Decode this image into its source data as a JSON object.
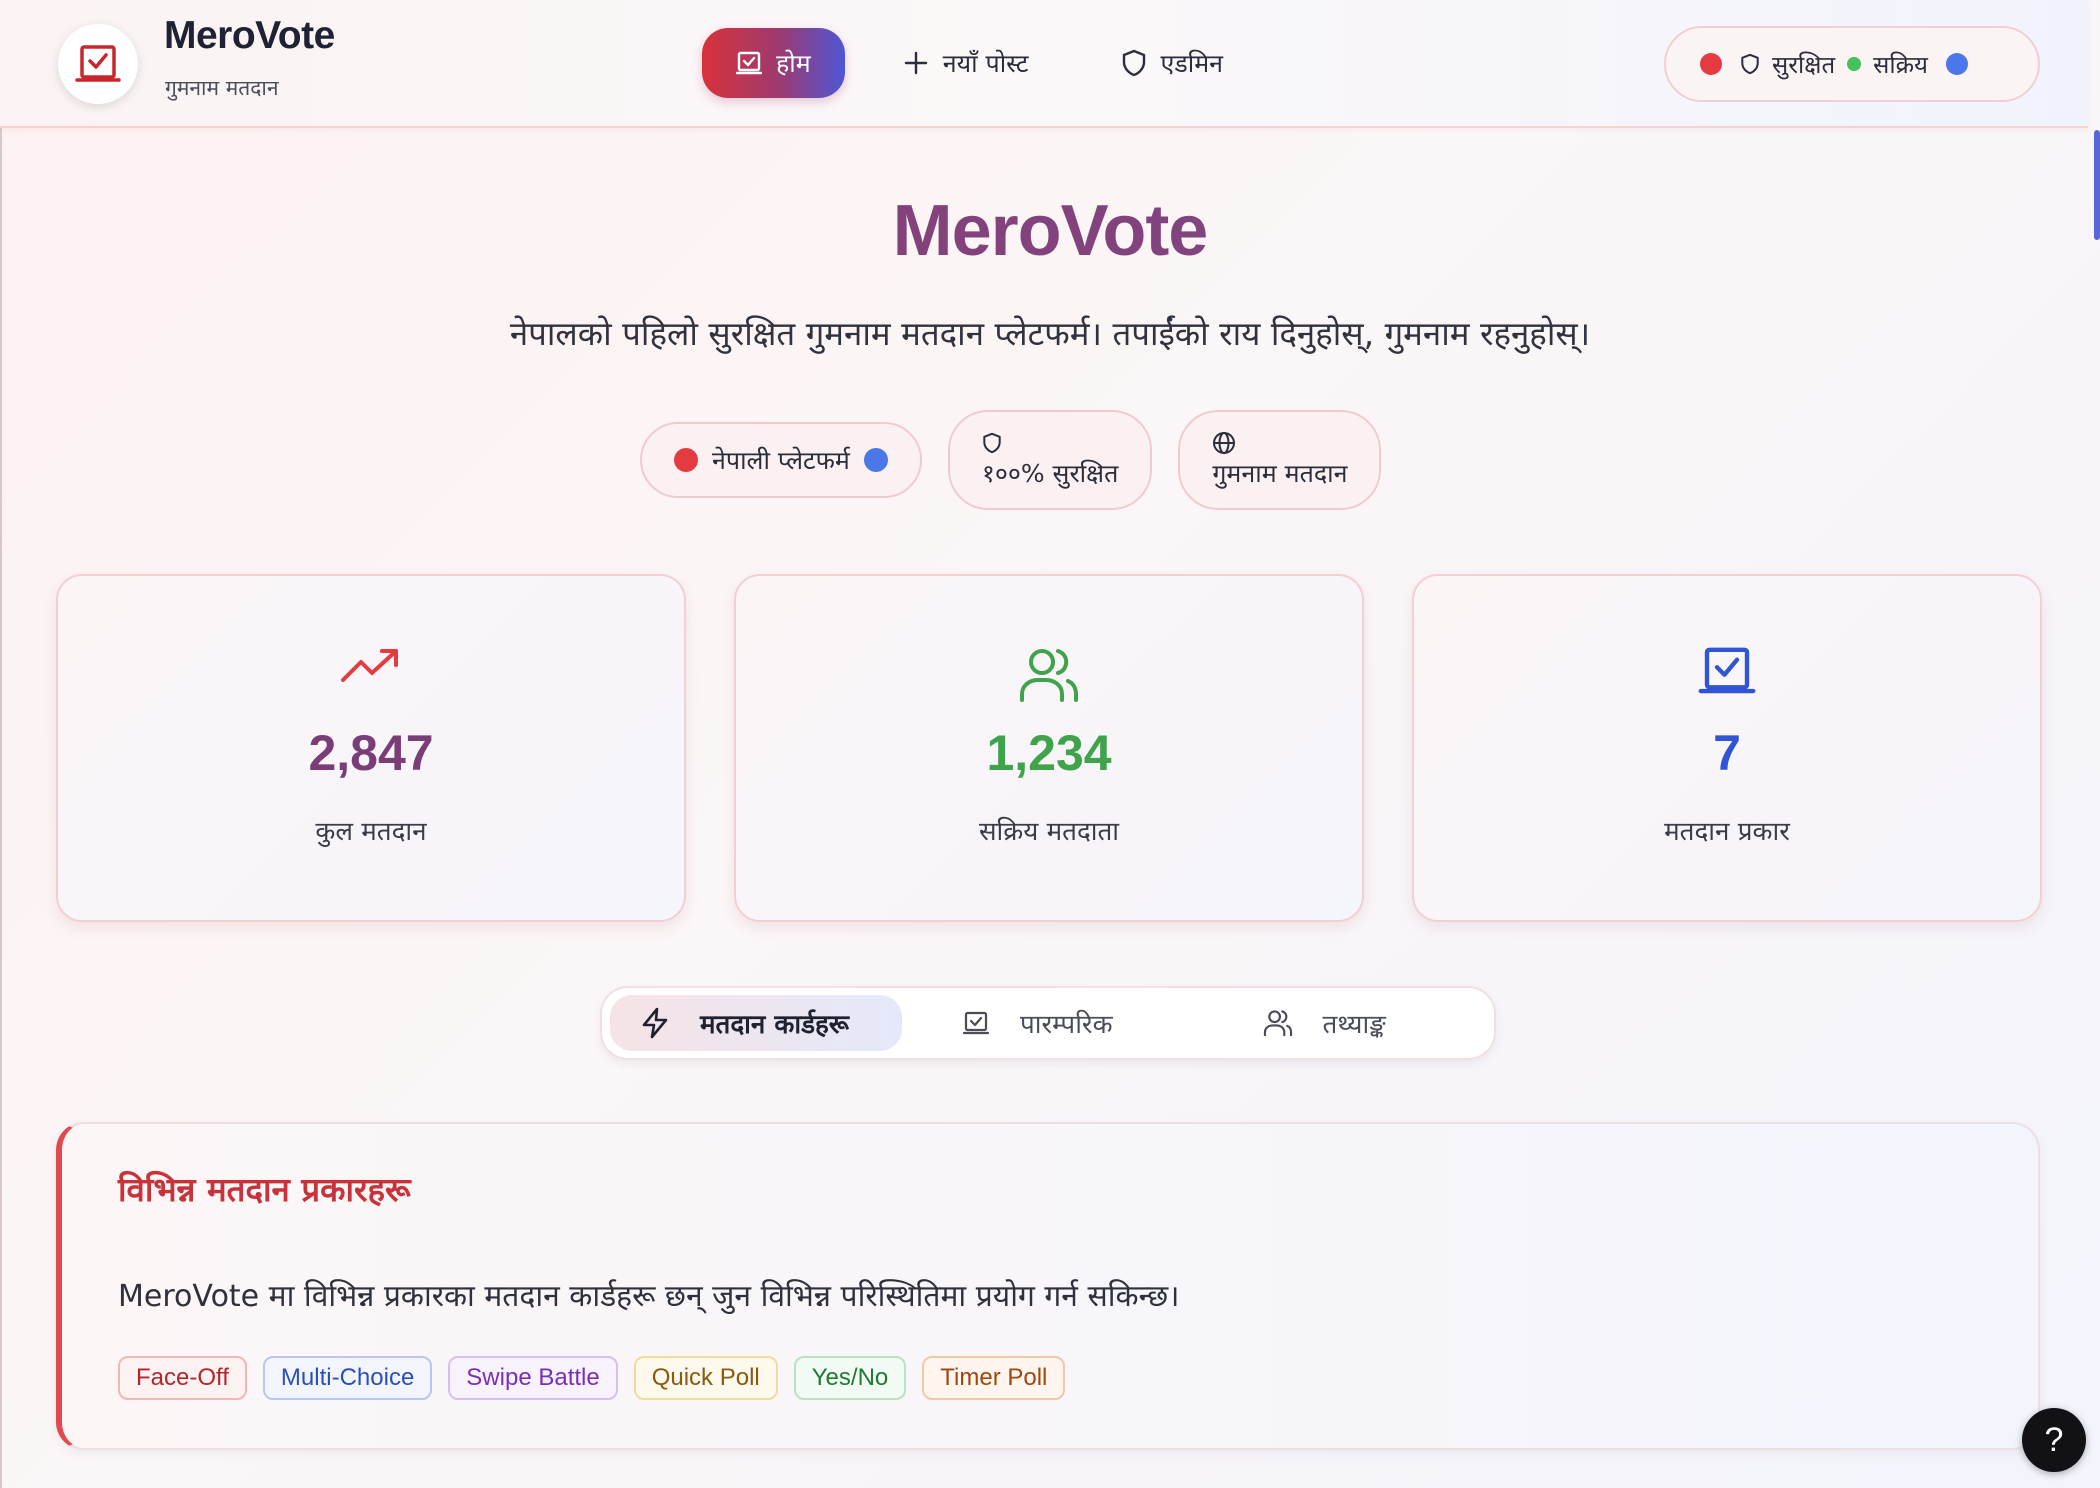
{
  "header": {
    "brand_name": "MeroVote",
    "brand_subtitle": "गुमनाम मतदान",
    "logo_icon": "ballot-box-icon",
    "nav": [
      {
        "label": "होम",
        "icon": "ballot-box-icon",
        "active": true
      },
      {
        "label": "नयाँ पोस्ट",
        "icon": "plus-icon",
        "active": false
      },
      {
        "label": "एडमिन",
        "icon": "shield-icon",
        "active": false
      }
    ],
    "status": {
      "secure_label": "सुरक्षित",
      "active_label": "सक्रिय"
    }
  },
  "hero": {
    "title": "MeroVote",
    "tagline": "नेपालको पहिलो सुरक्षित गुमनाम मतदान प्लेटफर्म। तपाईंको राय दिनुहोस्, गुमनाम रहनुहोस्।",
    "badges": [
      {
        "label": "नेपाली प्लेटफर्म",
        "icon": "flag-dots"
      },
      {
        "label": "१००% सुरक्षित",
        "icon": "shield-icon"
      },
      {
        "label": "गुमनाम मतदान",
        "icon": "globe-icon"
      }
    ]
  },
  "stats": [
    {
      "value": "2,847",
      "label": "कुल मतदान",
      "icon": "trending-up-icon",
      "color": "#7b3d77"
    },
    {
      "value": "1,234",
      "label": "सक्रिय मतदाता",
      "icon": "users-icon",
      "color": "#3ea34a"
    },
    {
      "value": "7",
      "label": "मतदान प्रकार",
      "icon": "ballot-box-icon",
      "color": "#2f55d4"
    }
  ],
  "tabs": [
    {
      "label": "मतदान कार्डहरू",
      "icon": "lightning-icon",
      "active": true
    },
    {
      "label": "पारम्परिक",
      "icon": "ballot-box-icon",
      "active": false
    },
    {
      "label": "तथ्याङ्क",
      "icon": "users-icon",
      "active": false
    }
  ],
  "info": {
    "title": "विभिन्न मतदान प्रकारहरू",
    "text": "MeroVote मा विभिन्न प्रकारका मतदान कार्डहरू छन् जुन विभिन्न परिस्थितिमा प्रयोग गर्न सकिन्छ।",
    "chips": [
      {
        "label": "Face-Off",
        "color": "#b3262c",
        "border": "#f2b5b8",
        "bg": "#fdf2f2"
      },
      {
        "label": "Multi-Choice",
        "color": "#2b4fb8",
        "border": "#b9c6f2",
        "bg": "#f3f5fd"
      },
      {
        "label": "Swipe Battle",
        "color": "#7a2fb5",
        "border": "#d6bff2",
        "bg": "#f8f2fd"
      },
      {
        "label": "Quick Poll",
        "color": "#8a5a10",
        "border": "#f0dc9c",
        "bg": "#fdf9ec"
      },
      {
        "label": "Yes/No",
        "color": "#1f7a35",
        "border": "#b8e2c0",
        "bg": "#f1faf3"
      },
      {
        "label": "Timer Poll",
        "color": "#a0460e",
        "border": "#f2c9a8",
        "bg": "#fdf5ee"
      }
    ]
  },
  "help_label": "?",
  "colors": {
    "red": "#e33b3f",
    "green": "#46c05a",
    "blue": "#4a78e8",
    "accent_gradient_start": "#d8323a",
    "accent_gradient_end": "#4d57d6"
  }
}
